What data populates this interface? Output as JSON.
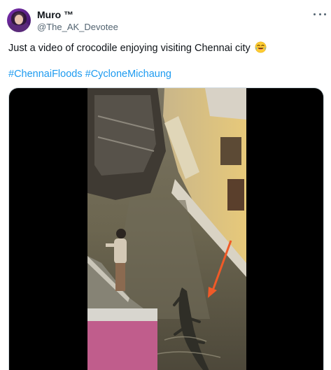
{
  "author": {
    "display_name": "Muro ™",
    "handle": "@The_AK_Devotee",
    "avatar_icon": "profile-photo"
  },
  "tweet": {
    "text": "Just a video of crocodile enjoying visiting Chennai city",
    "emoji_icon": "face-with-tears-of-joy",
    "hashtags": [
      "#ChennaiFloods",
      "#CycloneMichaung"
    ]
  },
  "menu": {
    "icon": "more-options-icon"
  },
  "media": {
    "kind": "video",
    "annotation_color": "#f05a28",
    "link_color": "#1d9bf0"
  }
}
